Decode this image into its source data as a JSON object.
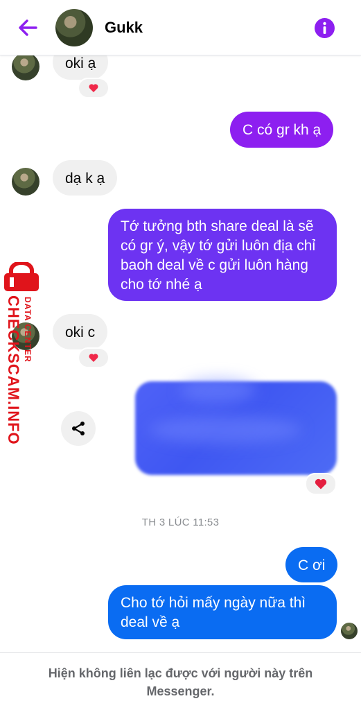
{
  "header": {
    "contact_name": "Gukk",
    "back_icon": "arrow-left-icon",
    "info_icon": "info-circle-icon",
    "accent_color": "#8d1ff0"
  },
  "messages": [
    {
      "direction": "in",
      "text": "oki ạ",
      "reaction": "heart-icon"
    },
    {
      "direction": "out",
      "text": "C có gr kh ạ",
      "color": "#8d1ff0"
    },
    {
      "direction": "in",
      "text": "dạ k ạ"
    },
    {
      "direction": "out",
      "text": "Tớ tưởng bth share deal là sẽ có gr ý, vậy tớ gửi luôn địa chỉ baoh deal về c gửi luôn hàng cho tớ nhé ạ",
      "color": "#6d33f2"
    },
    {
      "direction": "in",
      "text": "oki c",
      "reaction": "heart-icon"
    },
    {
      "direction": "out",
      "type": "attachment-blurred",
      "reaction": "heart-icon",
      "share_icon": "share-icon"
    },
    {
      "direction": "out",
      "text": "C ơi",
      "color": "#0a6cf2"
    },
    {
      "direction": "out",
      "text": "Cho tớ hỏi mấy ngày nữa thì deal về ạ",
      "color": "#0a6cf2"
    }
  ],
  "timestamp": "TH 3 LÚC 11:53",
  "footer": {
    "notice": "Hiện không liên lạc được với người này trên Messenger."
  },
  "watermark": {
    "brand": "CHECKSCAM.INFO",
    "tag": "DATA CENTER"
  }
}
